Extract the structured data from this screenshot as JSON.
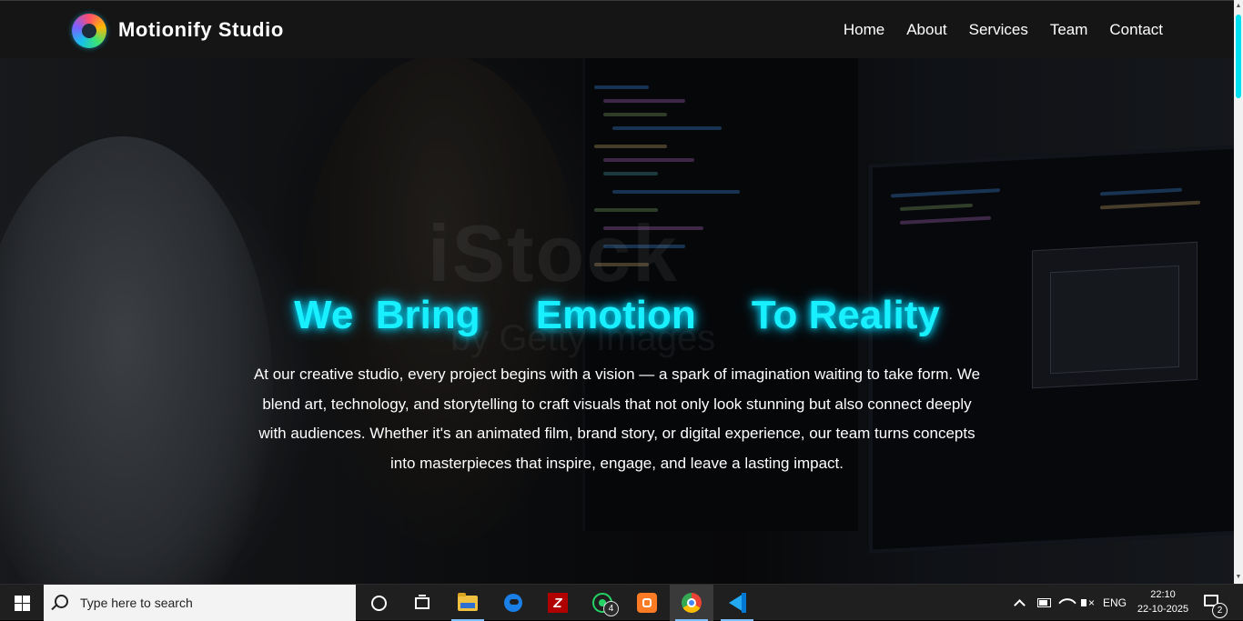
{
  "navbar": {
    "brand": "Motionify Studio",
    "links": [
      "Home",
      "About",
      "Services",
      "Team",
      "Contact"
    ]
  },
  "hero": {
    "headline": "We  Bring     Emotion     To Reality",
    "paragraph": "At our creative studio, every project begins with a vision — a spark of imagination waiting to take form. We blend art, technology, and storytelling to craft visuals that not only look stunning but also connect deeply with audiences. Whether it's an animated film, brand story, or digital experience, our team turns concepts into masterpieces that inspire, engage, and leave a lasting impact.",
    "watermark": "iStock",
    "watermark_sub": "by Getty Images",
    "accent_color": "#19f0ff"
  },
  "taskbar": {
    "search_placeholder": "Type here to search",
    "apps": [
      "file-explorer",
      "edge",
      "filezilla",
      "whatsapp",
      "xampp",
      "chrome",
      "vscode"
    ],
    "whatsapp_badge": "4",
    "language": "ENG",
    "time": "22:10",
    "date": "22-10-2025",
    "notification_count": "2"
  }
}
